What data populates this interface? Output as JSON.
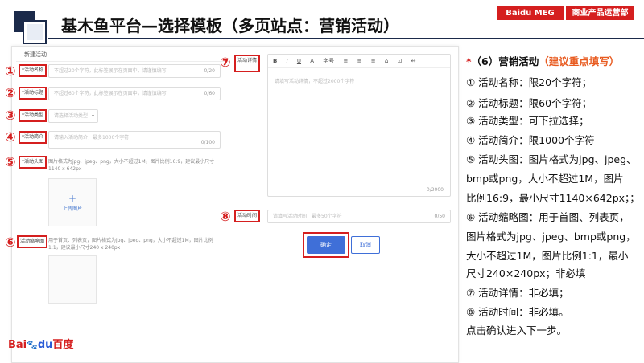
{
  "header": {
    "title": "基木鱼平台—选择模板（多页站点：营销活动）",
    "tag_left": "Baidu MEG",
    "tag_right": "商业产品运营部"
  },
  "form": {
    "panel_title": "新建活动",
    "fields": [
      {
        "num": "①",
        "label": "*活动名称",
        "placeholder": "不超过20个字符，此标签展示在页面中，请谨慎编写",
        "counter": "0/20"
      },
      {
        "num": "②",
        "label": "*活动标题",
        "placeholder": "不超过60个字符，此标签展示在页面中，请谨慎编写",
        "counter": "0/60"
      },
      {
        "num": "③",
        "label": "*活动类型",
        "placeholder": "请选择活动类型",
        "caret": "▾"
      },
      {
        "num": "④",
        "label": "*活动简介",
        "placeholder": "请输入活动简介，最多1000个字符",
        "counter": "0/100"
      },
      {
        "num": "⑤",
        "label": "*活动头图",
        "help": "图片格式为jpg、jpeg、png，大小不超过1M，图片比例16:9，建议最小尺寸1140 x 642px",
        "upload": "上传图片",
        "upload_icon": "+"
      },
      {
        "num": "⑥",
        "label": "活动缩略图",
        "help": "用于首页、列表页，图片格式为jpg、jpeg、png，大小不超过1M，图片比例1:1，建议最小尺寸240 x 240px"
      }
    ],
    "detail": {
      "num": "⑦",
      "label": "活动详情",
      "toolbar": [
        "B",
        "I",
        "U",
        "A",
        "字号",
        "≡",
        "≡",
        "≡",
        "⌂",
        "⊡",
        "↔"
      ],
      "placeholder": "请填写活动详情，不超过2000个字符",
      "counter": "0/2000"
    },
    "time": {
      "num": "⑧",
      "label": "活动时间",
      "placeholder": "请填写活动时间，最多50个字符",
      "counter": "0/50"
    },
    "ok_label": "确定",
    "cancel_label": "取消"
  },
  "notes": {
    "head_star": "*",
    "head": "（6）营销活动",
    "head_emphasis": "（建议重点填写）",
    "lines": [
      "① 活动名称：限20个字符；",
      "② 活动标题：限60个字符；",
      "③ 活动类型：可下拉选择；",
      "④ 活动简介：限1000个字符",
      "⑤ 活动头图：图片格式为jpg、jpeg、",
      "bmp或png，大小不超过1M，图片",
      "比例16:9，最小尺寸1140×642px；；",
      "⑥ 活动缩略图：用于首图、列表页，",
      "图片格式为jpg、jpeg、bmp或png，",
      "大小不超过1M，图片比例1:1，最小",
      "尺寸240×240px；非必填",
      "⑦ 活动详情：非必填；",
      "⑧ 活动时间：非必填。",
      "点击确认进入下一步。"
    ]
  },
  "logo": {
    "bai": "Bai",
    "paw": "🐾",
    "du": "du",
    "cn": "百度"
  },
  "colors": {
    "accent_red": "#d51f1f",
    "navy": "#1b2a4a",
    "button_blue": "#3f6fd8"
  }
}
